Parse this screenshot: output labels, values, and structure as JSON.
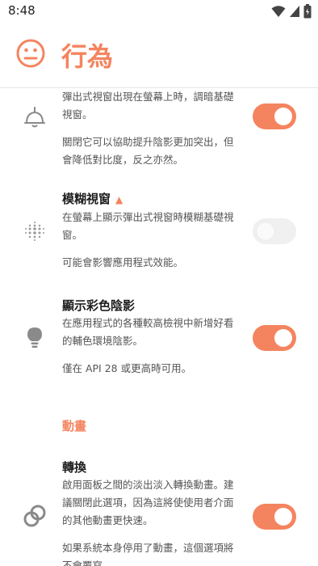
{
  "status_bar": {
    "time": "8:48",
    "icons": [
      "wifi-icon",
      "signal-icon",
      "battery-icon"
    ]
  },
  "header": {
    "title": "行為",
    "icon": "neutral-face-icon",
    "accent_color": "#f4845f"
  },
  "settings": [
    {
      "title": "",
      "desc": "彈出式視窗出現在螢幕上時，調暗基礎視窗。",
      "note": "關閉它可以協助提升陰影更加突出，但會降低對比度，反之亦然。",
      "icon": "lamp-icon",
      "toggle_on": true
    },
    {
      "title": "模糊視窗",
      "warning": "▲",
      "desc": "在螢幕上顯示彈出式視窗時模糊基礎視窗。",
      "note": "可能會影響應用程式效能。",
      "icon": "blur-dots-icon",
      "toggle_on": false
    },
    {
      "title": "顯示彩色陰影",
      "desc": "在應用程式的各種較高檢視中新增好看的輔色環境陰影。",
      "note": "僅在 API 28 或更高時可用。",
      "icon": "lightbulb-icon",
      "toggle_on": true
    }
  ],
  "section_animation": {
    "header": "動畫",
    "item": {
      "title": "轉換",
      "desc": "啟用面板之間的淡出淡入轉換動畫。建議關閉此選項，因為這將使使用者介面的其他動畫更快速。",
      "note": "如果系統本身停用了動畫，這個選項將不會覆寫。",
      "icon": "transition-rings-icon",
      "toggle_on": true
    }
  }
}
